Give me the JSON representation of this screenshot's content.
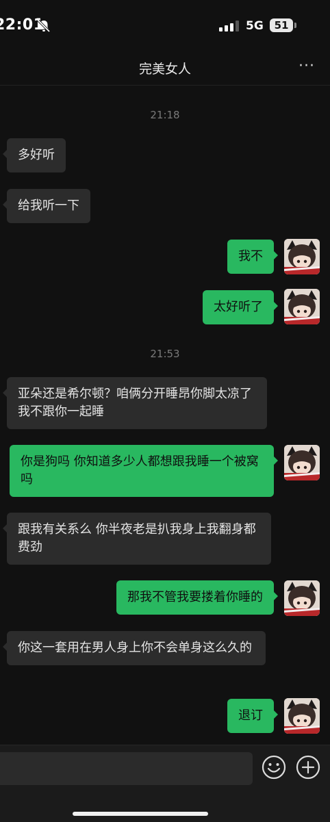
{
  "status_bar": {
    "time": "22:01",
    "network": "5G",
    "battery": "51"
  },
  "header": {
    "title": "完美女人",
    "more_label": "···"
  },
  "messages": {
    "time1": "21:18",
    "m1": "多好听",
    "m2": "给我听一下",
    "m3": "我不",
    "m4": "太好听了",
    "time2": "21:53",
    "m5": "亚朵还是希尔顿？咱俩分开睡昂你脚太凉了我不跟你一起睡",
    "m6": "你是狗吗 你知道多少人都想跟我睡一个被窝吗",
    "m7": "跟我有关系么 你半夜老是扒我身上我翻身都费劲",
    "m8": "那我不管我要搂着你睡的",
    "m9": "你这一套用在男人身上你不会单身这么久的",
    "m10": "退订"
  },
  "colors": {
    "background": "#111111",
    "incoming_bubble": "#2c2c2c",
    "outgoing_bubble": "#29b860"
  },
  "icons": [
    "bell-muted-icon",
    "signal-icon",
    "battery-icon",
    "more-icon",
    "emoji-icon",
    "plus-icon"
  ]
}
